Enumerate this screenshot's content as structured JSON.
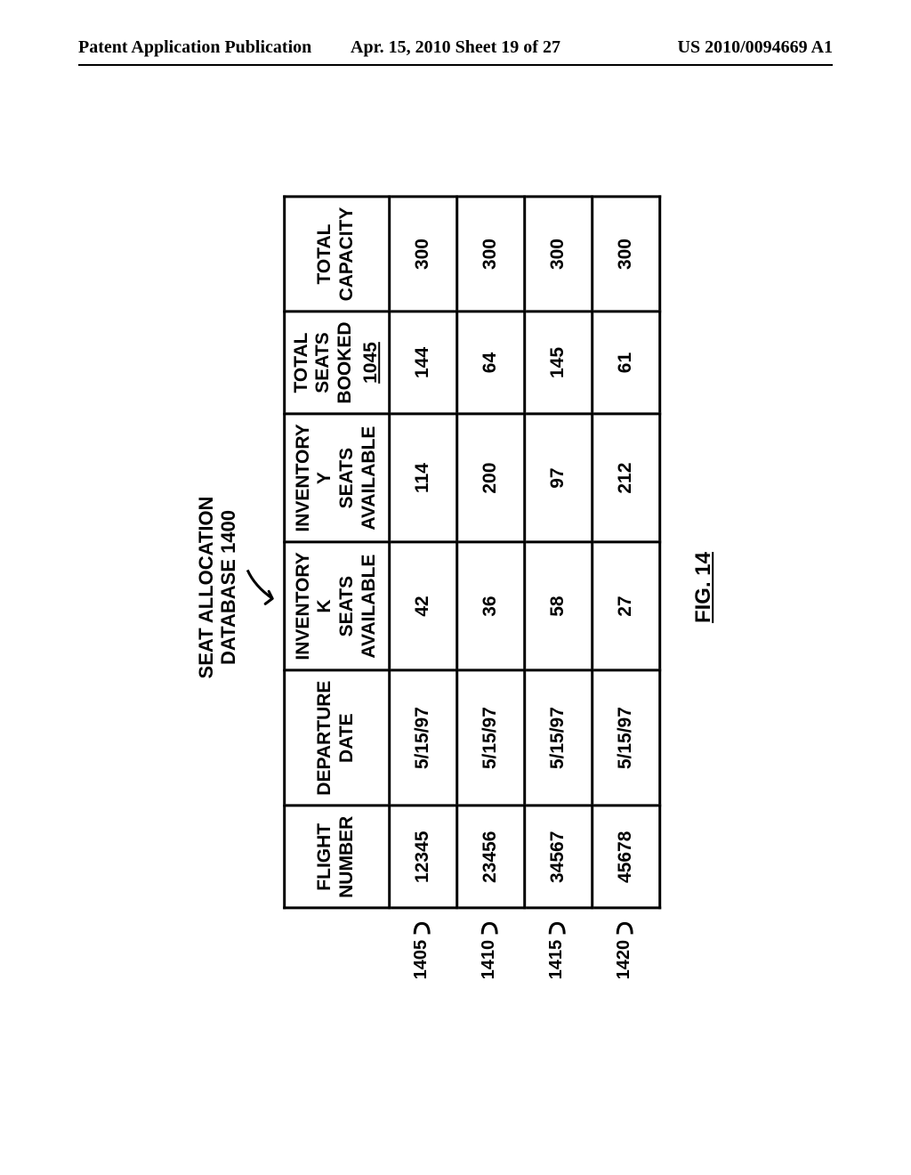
{
  "header": {
    "left": "Patent Application Publication",
    "center": "Apr. 15, 2010  Sheet 19 of 27",
    "right": "US 2010/0094669 A1"
  },
  "figure": {
    "title_line1": "SEAT ALLOCATION",
    "title_line2": "DATABASE  1400",
    "caption": "FIG. 14"
  },
  "row_refs": [
    "1405",
    "1410",
    "1415",
    "1420"
  ],
  "columns": {
    "flight": {
      "l1": "FLIGHT NUMBER"
    },
    "date": {
      "l1": "DEPARTURE",
      "l2": "DATE"
    },
    "invk": {
      "l1": "INVENTORY K",
      "l2": "SEATS",
      "l3": "AVAILABLE"
    },
    "invy": {
      "l1": "INVENTORY Y",
      "l2": "SEATS",
      "l3": "AVAILABLE"
    },
    "booked": {
      "l1": "TOTAL SEATS",
      "l2": "BOOKED",
      "ref": "1045"
    },
    "capacity": {
      "l1": "TOTAL",
      "l2": "CAPACITY"
    }
  },
  "rows": [
    {
      "flight": "12345",
      "date": "5/15/97",
      "invk": "42",
      "invy": "114",
      "booked": "144",
      "capacity": "300"
    },
    {
      "flight": "23456",
      "date": "5/15/97",
      "invk": "36",
      "invy": "200",
      "booked": "64",
      "capacity": "300"
    },
    {
      "flight": "34567",
      "date": "5/15/97",
      "invk": "58",
      "invy": "97",
      "booked": "145",
      "capacity": "300"
    },
    {
      "flight": "45678",
      "date": "5/15/97",
      "invk": "27",
      "invy": "212",
      "booked": "61",
      "capacity": "300"
    }
  ]
}
